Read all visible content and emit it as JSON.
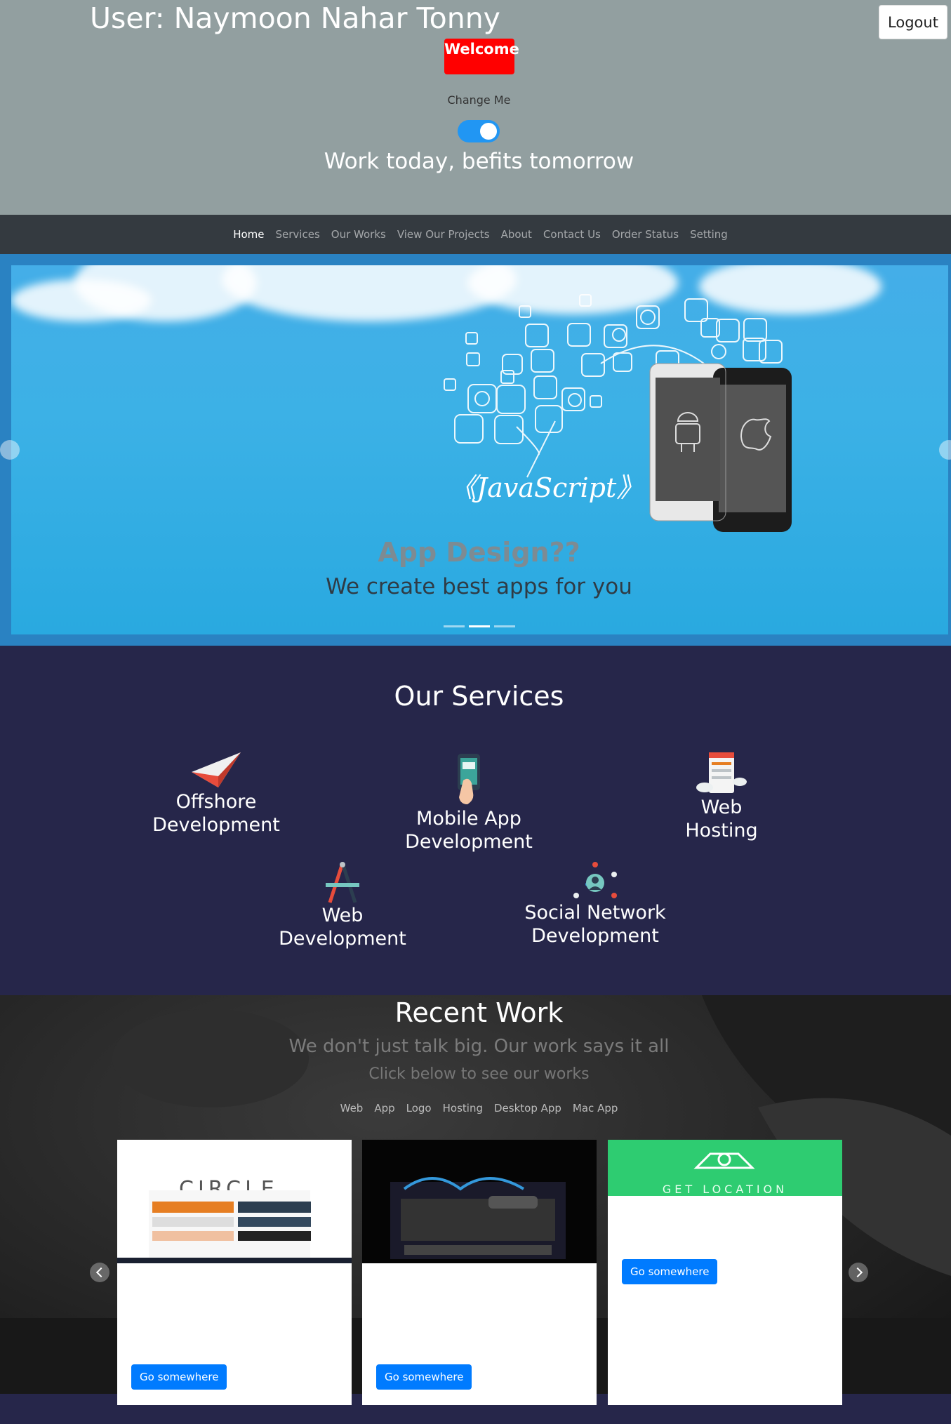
{
  "header": {
    "user_title": "User: Naymoon Nahar Tonny",
    "logout_label": "Logout",
    "welcome_label": "Welcome",
    "change_label": "Change Me",
    "motto": "Work today, befits tomorrow",
    "toggle_on": true
  },
  "navbar": {
    "items": [
      {
        "label": "Home",
        "active": true
      },
      {
        "label": "Services"
      },
      {
        "label": "Our Works"
      },
      {
        "label": "View Our Projects"
      },
      {
        "label": "About"
      },
      {
        "label": "Contact Us"
      },
      {
        "label": "Order Status"
      },
      {
        "label": "Setting"
      }
    ]
  },
  "carousel": {
    "slide_text": "《JavaScript》",
    "caption_title": "App Design??",
    "caption_sub": "We create best apps for you",
    "active_index": 1,
    "slides": 3
  },
  "services": {
    "title": "Our Services",
    "items": [
      {
        "line1": "Offshore",
        "line2": "Development",
        "icon": "paper-plane-icon"
      },
      {
        "line1": "Mobile App",
        "line2": "Development",
        "icon": "phone-touch-icon"
      },
      {
        "line1": "Web",
        "line2": "Hosting",
        "icon": "server-cloud-icon"
      },
      {
        "line1": "Web",
        "line2": "Development",
        "icon": "design-tools-icon"
      },
      {
        "line1": "Social Network",
        "line2": "Development",
        "icon": "network-user-icon"
      }
    ]
  },
  "work": {
    "title": "Recent Work",
    "subtitle": "We don't just talk big. Our work says it all",
    "subtitle2": "Click below to see our works",
    "filters": [
      "Web",
      "App",
      "Logo",
      "Hosting",
      "Desktop App",
      "Mac App"
    ],
    "cards": [
      {
        "button": "Go somewhere",
        "image_text": "CIRCLE"
      },
      {
        "button": "Go somewhere"
      },
      {
        "button": "Go somewhere",
        "image_text": "GET LOCATION"
      }
    ]
  },
  "colors": {
    "header_bg": "#929fa0",
    "navbar_bg": "#343a40",
    "services_bg": "#26264a",
    "welcome_bg": "#ff0000",
    "button_primary": "#007bff",
    "toggle_on": "#2196f3"
  }
}
